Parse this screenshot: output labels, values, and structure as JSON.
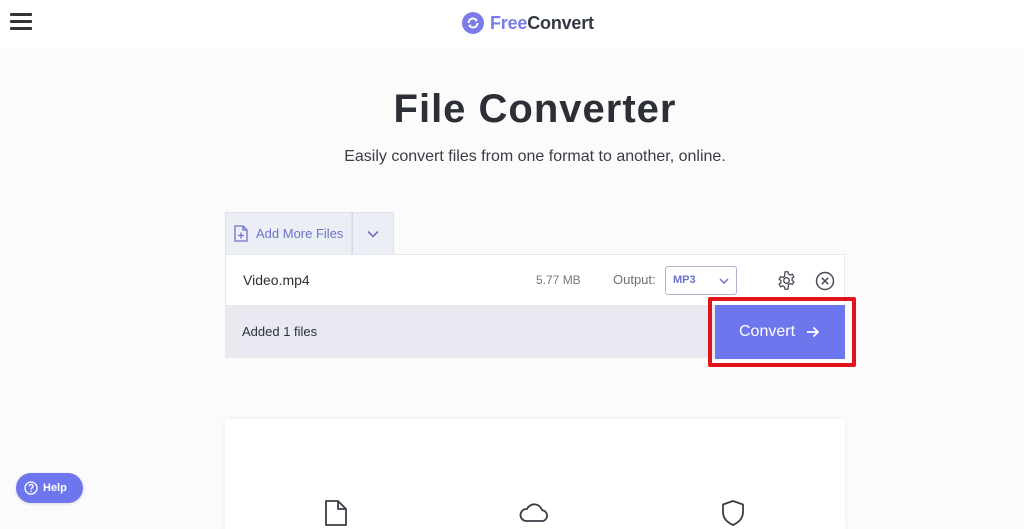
{
  "header": {
    "brand_free": "Free",
    "brand_convert": "Convert"
  },
  "hero": {
    "title": "File Converter",
    "subtitle": "Easily convert files from one format to another, online."
  },
  "uploader": {
    "add_more_label": "Add More Files",
    "file": {
      "name": "Video.mp4",
      "size": "5.77 MB",
      "output_label": "Output:",
      "output_value": "MP3"
    },
    "status": "Added 1 files",
    "convert_label": "Convert"
  },
  "help": {
    "label": "Help"
  },
  "colors": {
    "accent": "#6e76ee",
    "highlight": "#e0131b"
  }
}
